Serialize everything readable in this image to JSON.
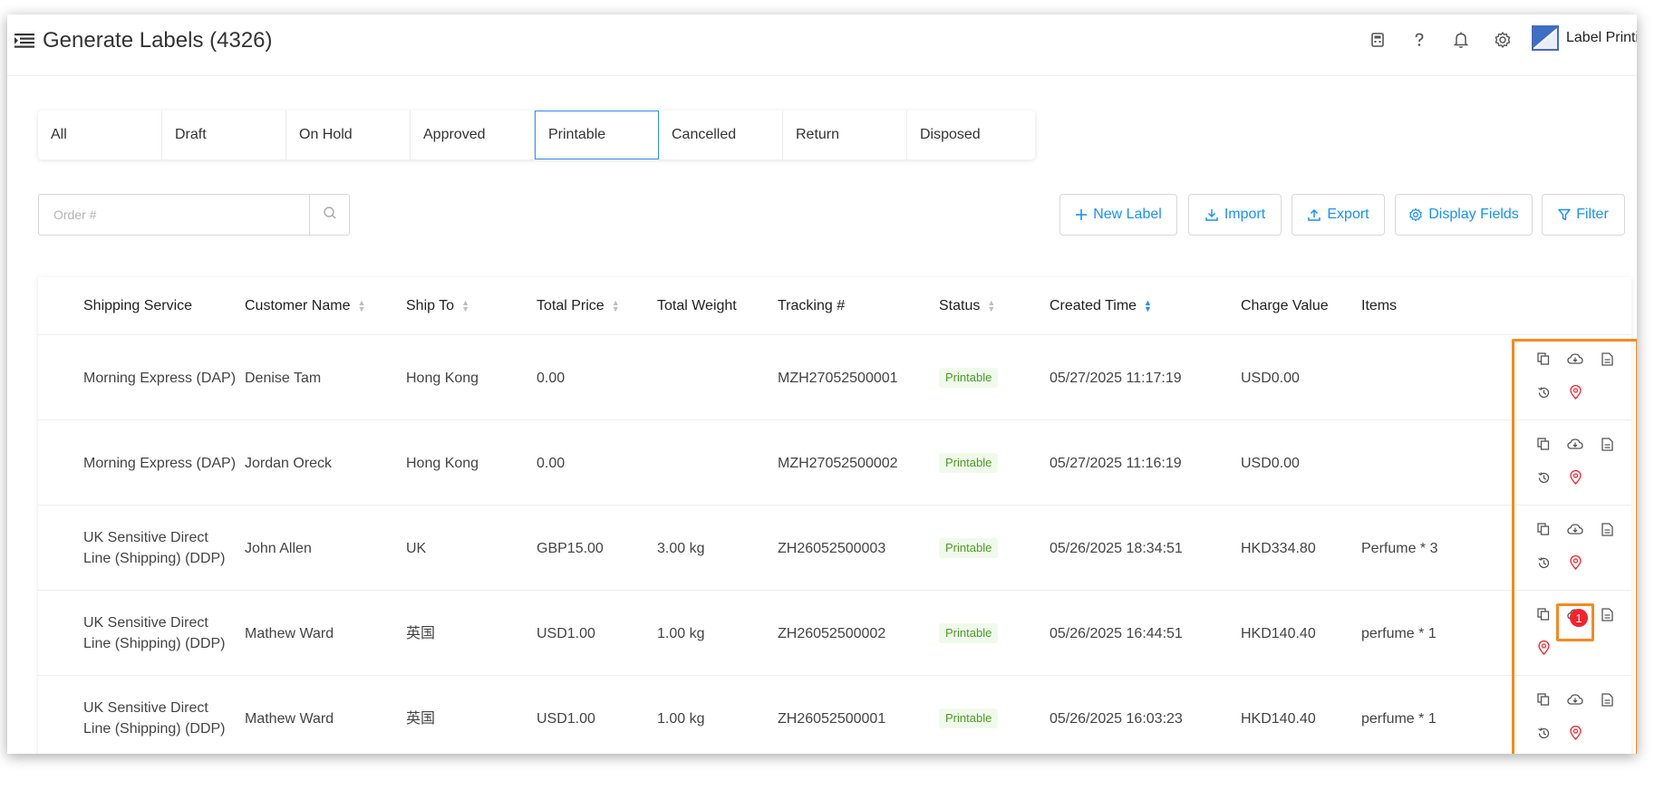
{
  "header": {
    "title": "Generate Labels (4326)",
    "brand": "Label Printing"
  },
  "tabs": [
    "All",
    "Draft",
    "On Hold",
    "Approved",
    "Printable",
    "Cancelled",
    "Return",
    "Disposed"
  ],
  "active_tab": "Printable",
  "search": {
    "placeholder": "Order #",
    "value": ""
  },
  "actions": {
    "new_label": "New Label",
    "import": "Import",
    "export": "Export",
    "display_fields": "Display Fields",
    "filter": "Filter"
  },
  "table": {
    "columns": {
      "shipping_service": "Shipping Service",
      "customer_name": "Customer Name",
      "ship_to": "Ship To",
      "total_price": "Total Price",
      "total_weight": "Total Weight",
      "tracking": "Tracking #",
      "status": "Status",
      "created_time": "Created Time",
      "charge_value": "Charge Value",
      "items": "Items"
    },
    "rows": [
      {
        "shipping_service": "Morning Express (DAP)",
        "customer_name": "Denise Tam",
        "ship_to": "Hong Kong",
        "total_price": "0.00",
        "total_weight": "",
        "tracking": "MZH27052500001",
        "status": "Printable",
        "created_time": "05/27/2025 11:17:19",
        "charge_value": "USD0.00",
        "items": ""
      },
      {
        "shipping_service": "Morning Express (DAP)",
        "customer_name": "Jordan Oreck",
        "ship_to": "Hong Kong",
        "total_price": "0.00",
        "total_weight": "",
        "tracking": "MZH27052500002",
        "status": "Printable",
        "created_time": "05/27/2025 11:16:19",
        "charge_value": "USD0.00",
        "items": ""
      },
      {
        "shipping_service": "UK Sensitive Direct Line (Shipping) (DDP)",
        "customer_name": "John Allen",
        "ship_to": "UK",
        "total_price": "GBP15.00",
        "total_weight": "3.00 kg",
        "tracking": "ZH26052500003",
        "status": "Printable",
        "created_time": "05/26/2025 18:34:51",
        "charge_value": "HKD334.80",
        "items": "Perfume * 3"
      },
      {
        "shipping_service": "UK Sensitive Direct Line (Shipping) (DDP)",
        "customer_name": "Mathew Ward",
        "ship_to": "英国",
        "total_price": "USD1.00",
        "total_weight": "1.00 kg",
        "tracking": "ZH26052500002",
        "status": "Printable",
        "created_time": "05/26/2025 16:44:51",
        "charge_value": "HKD140.40",
        "items": "perfume * 1"
      },
      {
        "shipping_service": "UK Sensitive Direct Line (Shipping) (DDP)",
        "customer_name": "Mathew Ward",
        "ship_to": "英国",
        "total_price": "USD1.00",
        "total_weight": "1.00 kg",
        "tracking": "ZH26052500001",
        "status": "Printable",
        "created_time": "05/26/2025 16:03:23",
        "charge_value": "HKD140.40",
        "items": "perfume * 1"
      }
    ]
  },
  "download_badge": "1",
  "colors": {
    "accent": "#1890ff",
    "status_bg": "#f0faeb",
    "status_text": "#4b9a23",
    "highlight": "#f58a1f",
    "badge": "#f5222d"
  },
  "icons": {
    "menu": "menu-fold-icon",
    "top_bar": [
      "calculator-icon",
      "help-icon",
      "bell-icon",
      "settings-icon"
    ],
    "row_actions": [
      "copy-icon",
      "cloud-download-icon",
      "file-icon",
      "history-icon",
      "location-pin-icon"
    ]
  }
}
